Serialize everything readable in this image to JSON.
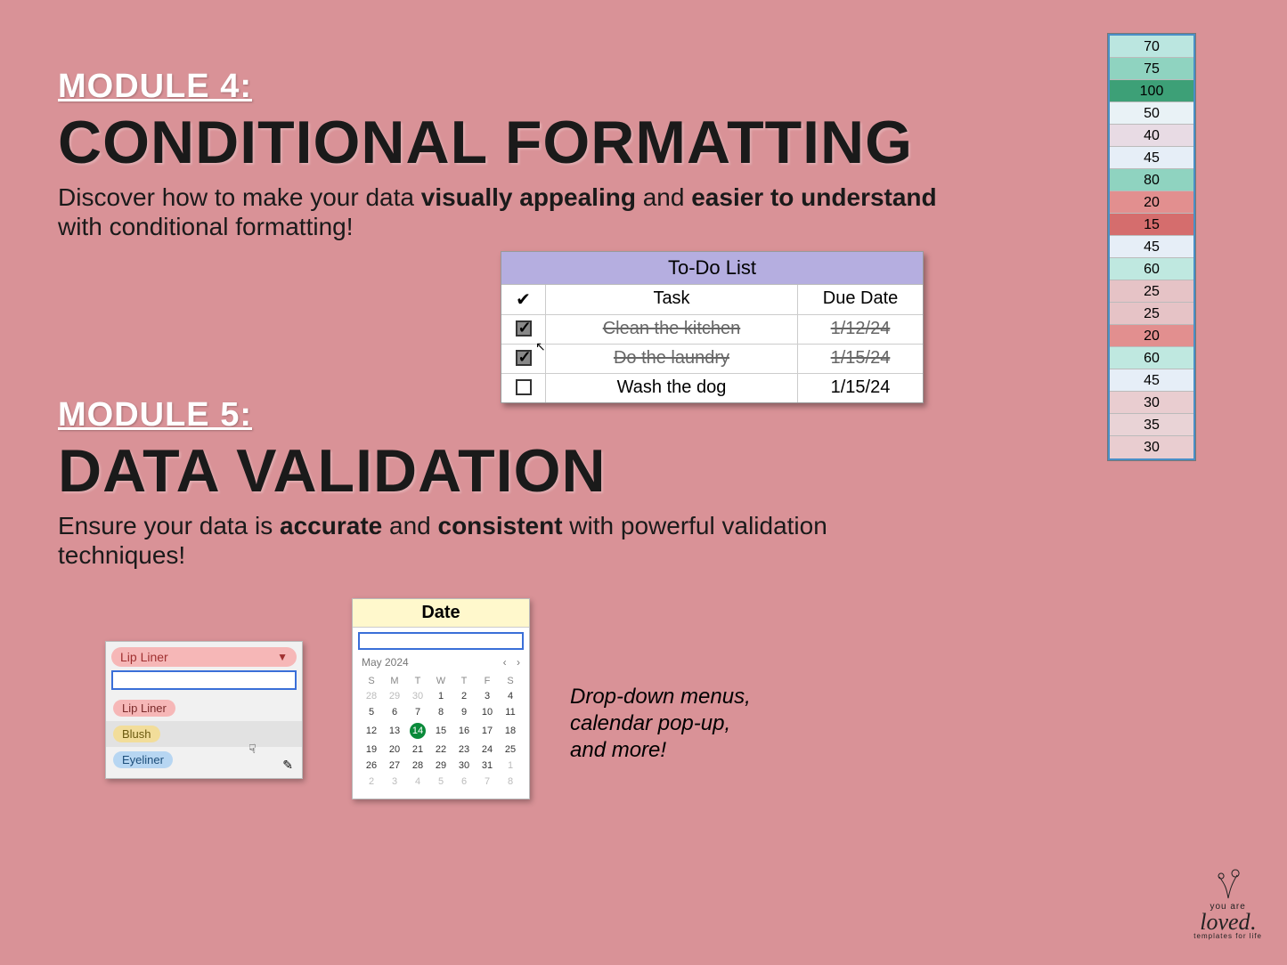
{
  "module4": {
    "label": "MODULE 4:",
    "title": "CONDITIONAL FORMATTING",
    "desc_pre": "Discover how to make your data ",
    "desc_b1": "visually appealing",
    "desc_mid": " and ",
    "desc_b2": "easier to understand",
    "desc_post": " with conditional formatting!"
  },
  "module5": {
    "label": "MODULE 5:",
    "title": "DATA VALIDATION",
    "desc_pre": "Ensure your data is ",
    "desc_b1": "accurate",
    "desc_mid": " and ",
    "desc_b2": "consistent",
    "desc_post": " with powerful validation techniques!"
  },
  "todo": {
    "title": "To-Do List",
    "headers": {
      "check": "✔",
      "task": "Task",
      "due": "Due Date"
    },
    "rows": [
      {
        "checked": true,
        "task": "Clean the kitchen",
        "due": "1/12/24"
      },
      {
        "checked": true,
        "task": "Do the laundry",
        "due": "1/15/24"
      },
      {
        "checked": false,
        "task": "Wash the dog",
        "due": "1/15/24"
      }
    ]
  },
  "color_col": [
    {
      "v": "70",
      "bg": "#bbe6e0"
    },
    {
      "v": "75",
      "bg": "#8fd3c0"
    },
    {
      "v": "100",
      "bg": "#3da077"
    },
    {
      "v": "50",
      "bg": "#e9f2f6"
    },
    {
      "v": "40",
      "bg": "#e8dbe4"
    },
    {
      "v": "45",
      "bg": "#e6eef7"
    },
    {
      "v": "80",
      "bg": "#8fd3c0"
    },
    {
      "v": "20",
      "bg": "#e28f8f"
    },
    {
      "v": "15",
      "bg": "#d56d6d"
    },
    {
      "v": "45",
      "bg": "#e6eef7"
    },
    {
      "v": "60",
      "bg": "#bfe8e0"
    },
    {
      "v": "25",
      "bg": "#e6c3c6"
    },
    {
      "v": "25",
      "bg": "#e6c3c6"
    },
    {
      "v": "20",
      "bg": "#e28f8f"
    },
    {
      "v": "60",
      "bg": "#bfe8e0"
    },
    {
      "v": "45",
      "bg": "#e6eef7"
    },
    {
      "v": "30",
      "bg": "#e9cdd0"
    },
    {
      "v": "35",
      "bg": "#e9d3d6"
    },
    {
      "v": "30",
      "bg": "#e9cdd0"
    }
  ],
  "dropdown": {
    "selected": "Lip Liner",
    "options": [
      {
        "label": "Lip Liner",
        "bg": "#f6b7b7",
        "fg": "#7a2a2a"
      },
      {
        "label": "Blush",
        "bg": "#f2dd9a",
        "fg": "#6b5a10"
      },
      {
        "label": "Eyeliner",
        "bg": "#b7d6f2",
        "fg": "#1d4e7a"
      }
    ]
  },
  "calendar": {
    "header": "Date",
    "month": "May 2024",
    "dow": [
      "S",
      "M",
      "T",
      "W",
      "T",
      "F",
      "S"
    ],
    "weeks": [
      [
        {
          "d": "28",
          "m": true
        },
        {
          "d": "29",
          "m": true
        },
        {
          "d": "30",
          "m": true
        },
        {
          "d": "1"
        },
        {
          "d": "2"
        },
        {
          "d": "3"
        },
        {
          "d": "4"
        }
      ],
      [
        {
          "d": "5"
        },
        {
          "d": "6"
        },
        {
          "d": "7"
        },
        {
          "d": "8"
        },
        {
          "d": "9"
        },
        {
          "d": "10"
        },
        {
          "d": "11"
        }
      ],
      [
        {
          "d": "12"
        },
        {
          "d": "13"
        },
        {
          "d": "14",
          "sel": true
        },
        {
          "d": "15"
        },
        {
          "d": "16"
        },
        {
          "d": "17"
        },
        {
          "d": "18"
        }
      ],
      [
        {
          "d": "19"
        },
        {
          "d": "20"
        },
        {
          "d": "21"
        },
        {
          "d": "22"
        },
        {
          "d": "23"
        },
        {
          "d": "24"
        },
        {
          "d": "25"
        }
      ],
      [
        {
          "d": "26"
        },
        {
          "d": "27"
        },
        {
          "d": "28"
        },
        {
          "d": "29"
        },
        {
          "d": "30"
        },
        {
          "d": "31"
        },
        {
          "d": "1",
          "m": true
        }
      ],
      [
        {
          "d": "2",
          "m": true
        },
        {
          "d": "3",
          "m": true
        },
        {
          "d": "4",
          "m": true
        },
        {
          "d": "5",
          "m": true
        },
        {
          "d": "6",
          "m": true
        },
        {
          "d": "7",
          "m": true
        },
        {
          "d": "8",
          "m": true
        }
      ]
    ]
  },
  "caption": {
    "l1": "Drop-down menus,",
    "l2": "calendar pop-up,",
    "l3": "and more!"
  },
  "logo": {
    "line1": "you are",
    "brand": "loved",
    "tag": "templates for life"
  }
}
